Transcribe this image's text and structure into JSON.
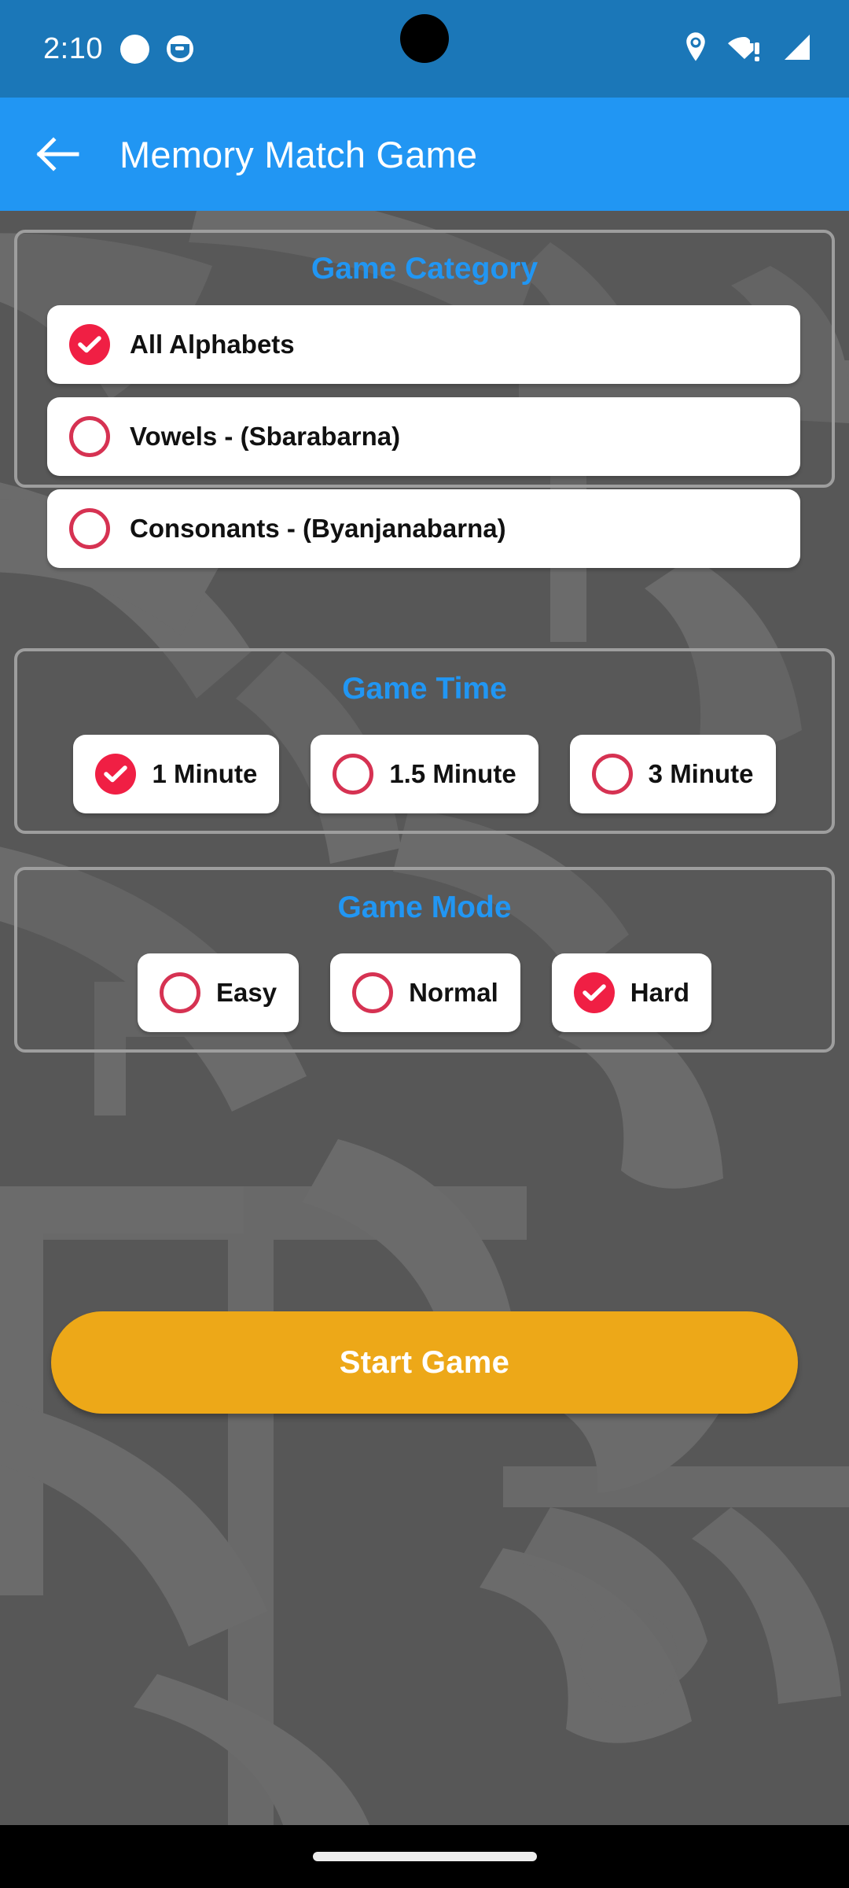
{
  "status_bar": {
    "time": "2:10",
    "notification_icons": [
      "circle-icon",
      "creature-icon"
    ],
    "system_icons": [
      "location-pin-icon",
      "wifi-alert-icon",
      "cellular-signal-icon"
    ]
  },
  "app_bar": {
    "back_icon": "back-arrow-icon",
    "title": "Memory Match Game"
  },
  "sections": [
    {
      "id": "game-category",
      "title": "Game Category",
      "layout": "list",
      "options": [
        {
          "label": "All Alphabets",
          "selected": true
        },
        {
          "label": "Vowels - (Sbarabarna)",
          "selected": false
        },
        {
          "label": "Consonants - (Byanjanabarna)",
          "selected": false
        }
      ]
    },
    {
      "id": "game-time",
      "title": "Game Time",
      "layout": "chips",
      "options": [
        {
          "label": "1 Minute",
          "selected": true
        },
        {
          "label": "1.5 Minute",
          "selected": false
        },
        {
          "label": "3 Minute",
          "selected": false
        }
      ]
    },
    {
      "id": "game-mode",
      "title": "Game Mode",
      "layout": "chips",
      "options": [
        {
          "label": "Easy",
          "selected": false
        },
        {
          "label": "Normal",
          "selected": false
        },
        {
          "label": "Hard",
          "selected": true
        }
      ]
    }
  ],
  "start_button": {
    "label": "Start Game"
  },
  "nav_bar": {
    "gesture_pill": "gesture-pill"
  },
  "colors": {
    "status_bar": "#1B77B8",
    "app_bar": "#2196F3",
    "background": "#575757",
    "section_border": "#9E9E9E",
    "section_title": "#2196F3",
    "radio_selected": "#F01F44",
    "radio_unselected": "#D63252",
    "start_button": "#EDA818",
    "card": "#FFFFFF",
    "nav_bar": "#000000"
  }
}
